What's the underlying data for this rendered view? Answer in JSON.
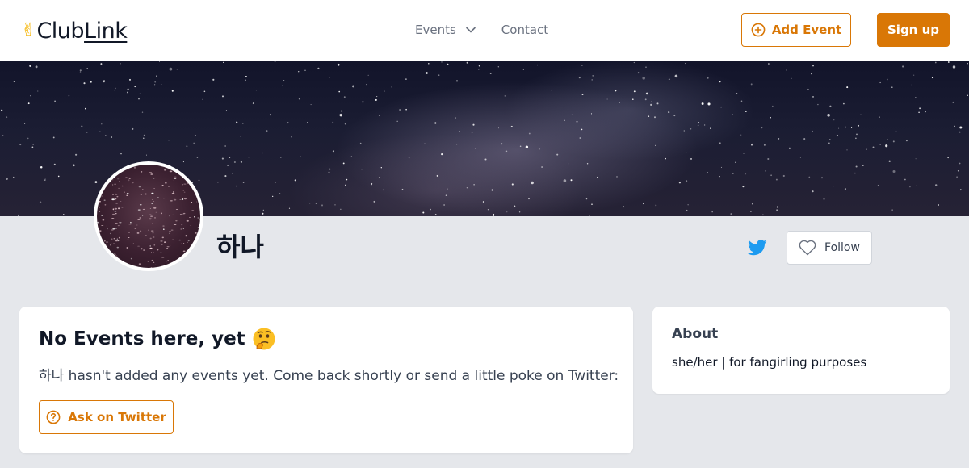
{
  "brand": {
    "hand_emoji": "✌",
    "name_part1": "Club",
    "name_part2": "Link"
  },
  "nav": {
    "events_label": "Events",
    "contact_label": "Contact"
  },
  "header_actions": {
    "add_event_label": "Add Event",
    "signup_label": "Sign up"
  },
  "profile": {
    "name": "하나",
    "follow_label": "Follow"
  },
  "events_card": {
    "title": "No Events here, yet",
    "description": "하나 hasn't added any events yet. Come back shortly or send a little poke on Twitter:",
    "ask_button_label": "Ask on Twitter"
  },
  "about_card": {
    "title": "About",
    "text": "she/her | for fangirling purposes"
  },
  "colors": {
    "accent": "#d97706",
    "twitter": "#1d9bf0",
    "page_bg": "#e5e7eb"
  },
  "icons": {
    "events_dropdown": "chevron-down-icon",
    "add_event": "plus-circle-icon",
    "twitter": "twitter-bird-icon",
    "follow": "heart-outline-icon",
    "ask": "question-circle-icon",
    "title_emoji": "thinking-face-emoji"
  }
}
